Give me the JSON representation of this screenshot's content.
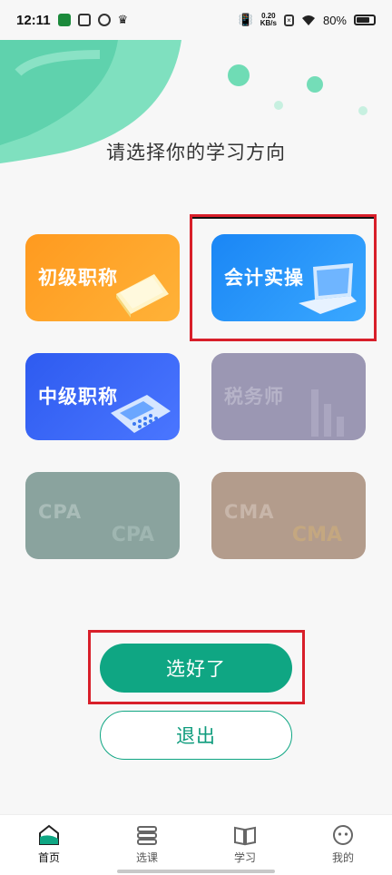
{
  "status_bar": {
    "time": "12:11",
    "net_speed_value": "0.20",
    "net_speed_unit": "KB/s",
    "battery": "80%",
    "battery_level": 0.8
  },
  "page_title": "请选择你的学习方向",
  "cards": [
    {
      "label": "初级职称",
      "enabled": true,
      "color": "#ff9a1f"
    },
    {
      "label": "会计实操",
      "enabled": true,
      "color": "#1a86f5"
    },
    {
      "label": "中级职称",
      "enabled": true,
      "color": "#2e5bf0"
    },
    {
      "label": "税务师",
      "enabled": false,
      "color": "#9b97b3"
    },
    {
      "label": "CPA",
      "enabled": false,
      "color": "#8aa39e"
    },
    {
      "label": "CMA",
      "enabled": false,
      "color": "#b39c8c"
    }
  ],
  "buttons": {
    "confirm": "选好了",
    "exit": "退出"
  },
  "bottom_nav": [
    {
      "label": "首页",
      "icon": "home-icon",
      "active": true
    },
    {
      "label": "选课",
      "icon": "books-icon",
      "active": false
    },
    {
      "label": "学习",
      "icon": "book-open-icon",
      "active": false
    },
    {
      "label": "我的",
      "icon": "profile-icon",
      "active": false
    }
  ],
  "colors": {
    "accent": "#0fa683",
    "highlight": "#d81f2a"
  }
}
